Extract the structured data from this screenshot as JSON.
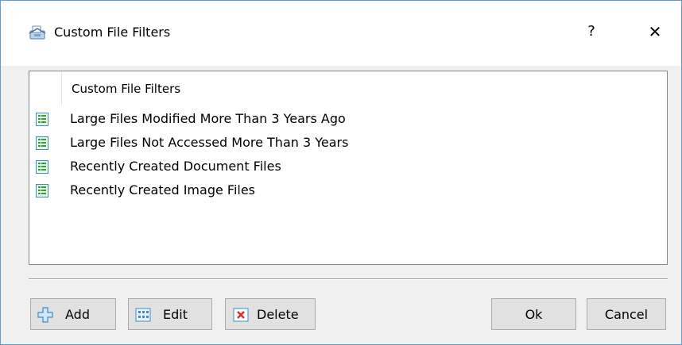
{
  "window": {
    "title": "Custom File Filters",
    "help_label": "?",
    "close_label": "✕"
  },
  "list": {
    "header": "Custom File Filters",
    "items": [
      {
        "label": "Large Files Modified More Than 3 Years Ago",
        "icon": "list-icon"
      },
      {
        "label": "Large Files Not Accessed More Than 3 Years",
        "icon": "list-icon"
      },
      {
        "label": "Recently Created Document Files",
        "icon": "list-icon"
      },
      {
        "label": "Recently Created Image Files",
        "icon": "list-icon"
      }
    ]
  },
  "buttons": {
    "add": "Add",
    "edit": "Edit",
    "delete": "Delete",
    "ok": "Ok",
    "cancel": "Cancel"
  },
  "colors": {
    "window_border": "#5e9ed6",
    "button_bg": "#e1e1e1",
    "button_border": "#adadad",
    "icon_green": "#33a033",
    "delete_red": "#d03030"
  }
}
